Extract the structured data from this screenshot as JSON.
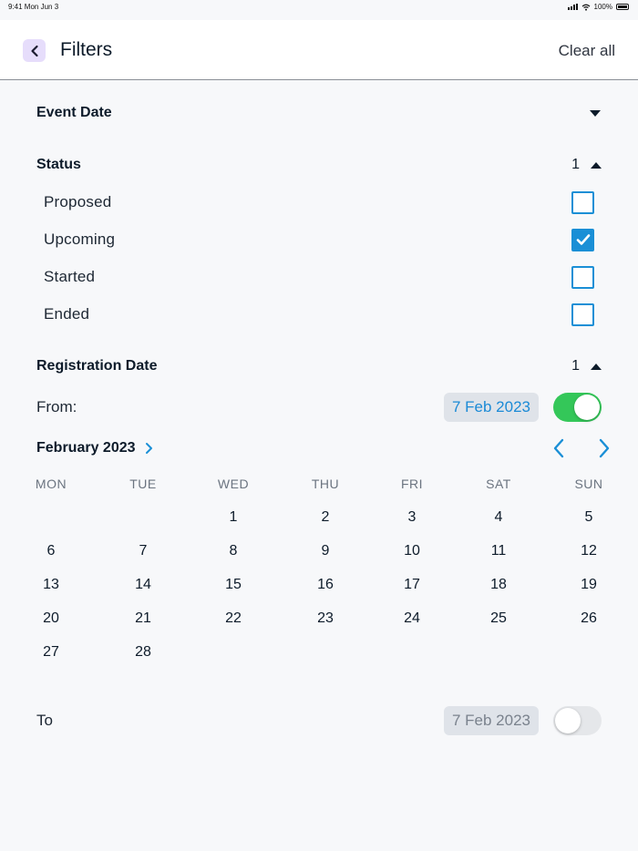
{
  "status_bar": {
    "time": "9:41 Mon Jun 3",
    "battery_text": "100%"
  },
  "header": {
    "title": "Filters",
    "clear_label": "Clear all"
  },
  "event_date": {
    "title": "Event Date"
  },
  "status": {
    "title": "Status",
    "count": "1",
    "options": [
      {
        "label": "Proposed",
        "checked": false
      },
      {
        "label": "Upcoming",
        "checked": true
      },
      {
        "label": "Started",
        "checked": false
      },
      {
        "label": "Ended",
        "checked": false
      }
    ]
  },
  "registration_date": {
    "title": "Registration Date",
    "count": "1",
    "from": {
      "label": "From:",
      "date": "7 Feb 2023",
      "enabled": true
    },
    "to": {
      "label": "To",
      "date": "7 Feb 2023",
      "enabled": false
    }
  },
  "calendar": {
    "month_label": "February 2023",
    "weekdays": [
      "MON",
      "TUE",
      "WED",
      "THU",
      "FRI",
      "SAT",
      "SUN"
    ],
    "weeks": [
      [
        "",
        "",
        "1",
        "2",
        "3",
        "4",
        "5"
      ],
      [
        "6",
        "7",
        "8",
        "9",
        "10",
        "11",
        "12"
      ],
      [
        "13",
        "14",
        "15",
        "16",
        "17",
        "18",
        "19"
      ],
      [
        "20",
        "21",
        "22",
        "23",
        "24",
        "25",
        "26"
      ],
      [
        "27",
        "28",
        "",
        "",
        "",
        "",
        ""
      ]
    ]
  },
  "colors": {
    "accent": "#1a8fd6",
    "toggle_on": "#34c759",
    "back_bg": "#e6ddfb"
  }
}
